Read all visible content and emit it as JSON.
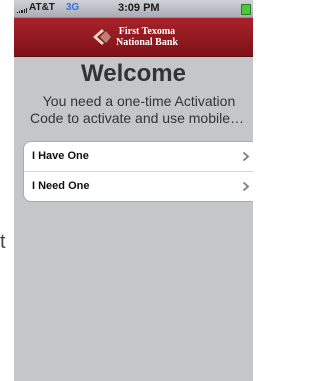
{
  "status_bar": {
    "carrier": "AT&T",
    "network": "3G",
    "time": "3:09 PM",
    "signal_icon": "signal-bars-icon",
    "battery_icon": "battery-icon",
    "network_color": "#3b6fd8"
  },
  "header": {
    "logo_icon": "bank-logo-icon",
    "bank_name_line1": "First Texoma",
    "bank_name_line2": "National Bank",
    "background_color": "#961b22"
  },
  "welcome": {
    "title": "Welcome",
    "description_line1": "You need a one-time Activation",
    "description_line2": "Code to activate and use mobile…"
  },
  "options": [
    {
      "label": "I Have One",
      "icon": "chevron-right-icon"
    },
    {
      "label": "I Need One",
      "icon": "chevron-right-icon"
    }
  ],
  "background_edge_text": "t"
}
